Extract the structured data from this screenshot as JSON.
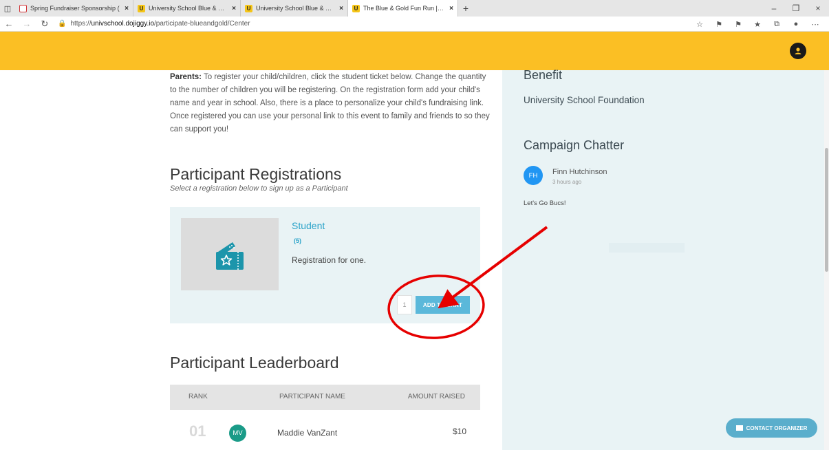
{
  "browser": {
    "tabs": [
      {
        "title": "Spring Fundraiser Sponsorship (",
        "icon": "pdf-icon",
        "active": false
      },
      {
        "title": "University School Blue & Gold Fu",
        "icon": "u-icon",
        "active": false
      },
      {
        "title": "University School Blue & Gold Fu",
        "icon": "u-icon",
        "active": false
      },
      {
        "title": "The Blue & Gold Fun Run | DoJig",
        "icon": "u-icon",
        "active": true
      }
    ],
    "url_prefix": "https://",
    "url_host": "univschool.dojiggy.io",
    "url_path": "/participate-blueandgold/Center"
  },
  "intro": {
    "lead": "Parents:",
    "text": " To register your child/children, click the student ticket below.  Change the quantity to the number of children you will be registering.  On the registration form add your child's name and year in school. Also, there is a place to personalize your child's fundraising link. Once registered you can use your personal link to this event to family and friends to so they can support you!"
  },
  "registrations": {
    "title": "Participant Registrations",
    "subtitle": "Select a registration below to sign up as a Participant",
    "ticket": {
      "name": "Student",
      "count": "(5)",
      "description": "Registration for one.",
      "quantity": "1",
      "button": "ADD TO CART"
    }
  },
  "leaderboard": {
    "title": "Participant Leaderboard",
    "headers": {
      "rank": "RANK",
      "name": "PARTICIPANT NAME",
      "amount": "AMOUNT RAISED"
    },
    "rows": [
      {
        "rank": "01",
        "initials": "MV",
        "name": "Maddie VanZant",
        "amount": "$10",
        "avatar_color": "#1a9b88"
      }
    ]
  },
  "sidebar": {
    "benefit_title": "Benefit",
    "benefit_org": "University School Foundation",
    "chatter_title": "Campaign Chatter",
    "chatter": {
      "initials": "FH",
      "name": "Finn Hutchinson",
      "time": "3 hours ago",
      "message": "Let's Go Bucs!",
      "avatar_color": "#2196f3"
    }
  },
  "contact_button": "CONTACT ORGANIZER",
  "colors": {
    "header": "#fbbf24",
    "accent": "#2aa3c9",
    "panel": "#e9f3f5",
    "annotation": "#e60000"
  }
}
